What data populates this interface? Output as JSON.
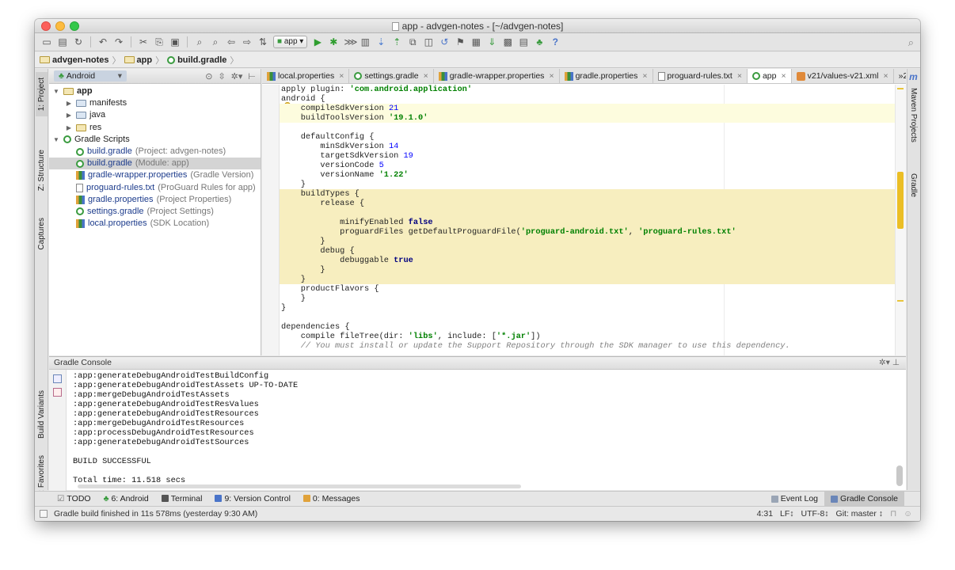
{
  "window": {
    "title": "app - advgen-notes - [~/advgen-notes]"
  },
  "toolbar": {
    "run_config": "app",
    "help": "?"
  },
  "breadcrumb": {
    "items": [
      "advgen-notes",
      "app",
      "build.gradle"
    ]
  },
  "left_stripe": {
    "project": "1: Project",
    "structure": "Z: Structure",
    "captures": "Captures",
    "build_variants": "Build Variants",
    "favorites": "2: Favorites"
  },
  "right_stripe": {
    "maven": "Maven Projects",
    "gradle": "Gradle",
    "m_label": "m"
  },
  "project_panel": {
    "view_selector": "Android",
    "tree": [
      {
        "label": "app",
        "hint": "",
        "level": 0,
        "icon": "module-folder-icon",
        "expanded": true
      },
      {
        "label": "manifests",
        "hint": "",
        "level": 1,
        "icon": "folder-icon",
        "expanded": false
      },
      {
        "label": "java",
        "hint": "",
        "level": 1,
        "icon": "folder-icon",
        "expanded": false
      },
      {
        "label": "res",
        "hint": "",
        "level": 1,
        "icon": "res-folder-icon",
        "expanded": false
      },
      {
        "label": "Gradle Scripts",
        "hint": "",
        "level": 0,
        "icon": "gradle-icon",
        "expanded": true
      },
      {
        "label": "build.gradle",
        "hint": "(Project: advgen-notes)",
        "level": 1,
        "icon": "gradle-icon"
      },
      {
        "label": "build.gradle",
        "hint": "(Module: app)",
        "level": 1,
        "icon": "gradle-icon",
        "selected": true
      },
      {
        "label": "gradle-wrapper.properties",
        "hint": "(Gradle Version)",
        "level": 1,
        "icon": "properties-icon"
      },
      {
        "label": "proguard-rules.txt",
        "hint": "(ProGuard Rules for app)",
        "level": 1,
        "icon": "text-file-icon"
      },
      {
        "label": "gradle.properties",
        "hint": "(Project Properties)",
        "level": 1,
        "icon": "properties-icon"
      },
      {
        "label": "settings.gradle",
        "hint": "(Project Settings)",
        "level": 1,
        "icon": "gradle-icon"
      },
      {
        "label": "local.properties",
        "hint": "(SDK Location)",
        "level": 1,
        "icon": "properties-icon"
      }
    ]
  },
  "editor_tabs": [
    {
      "label": "local.properties",
      "icon": "properties-icon"
    },
    {
      "label": "settings.gradle",
      "icon": "gradle-icon"
    },
    {
      "label": "gradle-wrapper.properties",
      "icon": "properties-icon"
    },
    {
      "label": "gradle.properties",
      "icon": "properties-icon"
    },
    {
      "label": "proguard-rules.txt",
      "icon": "text-file-icon"
    },
    {
      "label": "app",
      "icon": "gradle-icon",
      "active": true
    },
    {
      "label": "v21/values-v21.xml",
      "icon": "xml-icon"
    }
  ],
  "editor_tab_overflow": "»2",
  "code_lines": [
    [
      [
        "apply plugin: ",
        ""
      ],
      [
        "'com.android.application'",
        "str"
      ]
    ],
    [
      [
        "android {",
        ""
      ]
    ],
    [
      [
        "    compileSdkVersion ",
        ""
      ],
      [
        "21",
        "num"
      ]
    ],
    [
      [
        "    buildToolsVersion ",
        ""
      ],
      [
        "'19.1.0'",
        "str"
      ]
    ],
    [
      [
        "",
        ""
      ]
    ],
    [
      [
        "    defaultConfig {",
        ""
      ]
    ],
    [
      [
        "        minSdkVersion ",
        ""
      ],
      [
        "14",
        "num"
      ]
    ],
    [
      [
        "        targetSdkVersion ",
        ""
      ],
      [
        "19",
        "num"
      ]
    ],
    [
      [
        "        versionCode ",
        ""
      ],
      [
        "5",
        "num"
      ]
    ],
    [
      [
        "        versionName ",
        ""
      ],
      [
        "'1.22'",
        "str"
      ]
    ],
    [
      [
        "    }",
        ""
      ]
    ],
    [
      [
        "    buildTypes {",
        ""
      ]
    ],
    [
      [
        "        release {",
        ""
      ]
    ],
    [
      [
        "",
        ""
      ]
    ],
    [
      [
        "            minifyEnabled ",
        ""
      ],
      [
        "false",
        "kw"
      ]
    ],
    [
      [
        "            proguardFiles getDefaultProguardFile(",
        ""
      ],
      [
        "'proguard-android.txt'",
        "str"
      ],
      [
        ", ",
        ""
      ],
      [
        "'proguard-rules.txt'",
        "str"
      ]
    ],
    [
      [
        "        }",
        ""
      ]
    ],
    [
      [
        "        debug {",
        ""
      ]
    ],
    [
      [
        "            debuggable ",
        ""
      ],
      [
        "true",
        "kw"
      ]
    ],
    [
      [
        "        }",
        ""
      ]
    ],
    [
      [
        "    }",
        ""
      ]
    ],
    [
      [
        "    productFlavors {",
        ""
      ]
    ],
    [
      [
        "    }",
        ""
      ]
    ],
    [
      [
        "}",
        ""
      ]
    ],
    [
      [
        "",
        ""
      ]
    ],
    [
      [
        "dependencies {",
        ""
      ]
    ],
    [
      [
        "    compile fileTree(dir: ",
        ""
      ],
      [
        "'libs'",
        "str"
      ],
      [
        ", include: [",
        ""
      ],
      [
        "'*.jar'",
        "str"
      ],
      [
        "])",
        ""
      ]
    ],
    [
      [
        "    // You must install or update the Support Repository through the SDK manager to use this dependency.",
        "cm"
      ]
    ]
  ],
  "gradle_console": {
    "title": "Gradle Console",
    "lines": [
      ":app:generateDebugAndroidTestBuildConfig",
      ":app:generateDebugAndroidTestAssets UP-TO-DATE",
      ":app:mergeDebugAndroidTestAssets",
      ":app:generateDebugAndroidTestResValues",
      ":app:generateDebugAndroidTestResources",
      ":app:mergeDebugAndroidTestResources",
      ":app:processDebugAndroidTestResources",
      ":app:generateDebugAndroidTestSources",
      "",
      "BUILD SUCCESSFUL",
      "",
      "Total time: 11.518 secs"
    ]
  },
  "bottom_tabs": {
    "todo": "TODO",
    "android": "6: Android",
    "terminal": "Terminal",
    "vcs": "9: Version Control",
    "messages": "0: Messages",
    "event_log": "Event Log",
    "gradle_console": "Gradle Console"
  },
  "status": {
    "message": "Gradle build finished in 11s 578ms (yesterday 9:30 AM)",
    "position": "4:31",
    "line_sep": "LF↕",
    "encoding": "UTF-8↕",
    "git": "Git: master ↕"
  },
  "colors": {
    "accent_green": "#3a9b3f",
    "highlight_block": "#f7eebf",
    "selection": "#d4d4d4",
    "scroll_marker": "#e9b400"
  }
}
